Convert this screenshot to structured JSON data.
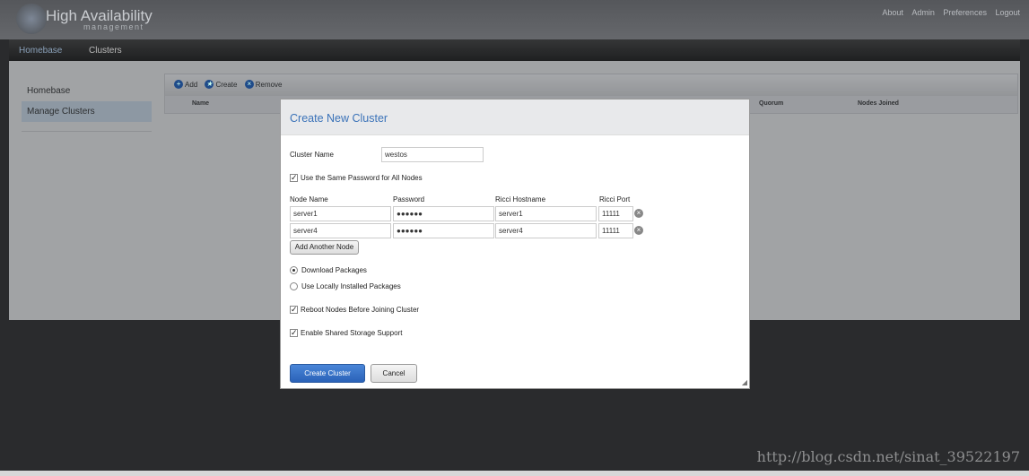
{
  "header": {
    "title": "High Availability",
    "subtitle": "management",
    "links": [
      "About",
      "Admin",
      "Preferences",
      "Logout"
    ]
  },
  "breadcrumb": [
    "Homebase",
    "Clusters"
  ],
  "sidebar": {
    "items": [
      {
        "label": "Homebase"
      },
      {
        "label": "Manage Clusters",
        "selected": true
      }
    ]
  },
  "toolbar": {
    "add": "Add",
    "create": "Create",
    "remove": "Remove"
  },
  "table": {
    "columns": [
      "Name",
      "Quorum",
      "Nodes Joined"
    ]
  },
  "modal": {
    "title": "Create New Cluster",
    "cluster_name_label": "Cluster Name",
    "cluster_name": "westos",
    "same_password_label": "Use the Same Password for All Nodes",
    "same_password": true,
    "columns": [
      "Node Name",
      "Password",
      "Ricci Hostname",
      "Ricci Port"
    ],
    "nodes": [
      {
        "name": "server1",
        "password": "●●●●●●",
        "hostname": "server1",
        "port": "11111"
      },
      {
        "name": "server4",
        "password": "●●●●●●",
        "hostname": "server4",
        "port": "11111"
      }
    ],
    "add_node": "Add Another Node",
    "download_label": "Download Packages",
    "local_label": "Use Locally Installed Packages",
    "package_choice": "Download Packages",
    "reboot_label": "Reboot Nodes Before Joining Cluster",
    "reboot": true,
    "shared_label": "Enable Shared Storage Support",
    "shared": true,
    "create_button": "Create Cluster",
    "cancel_button": "Cancel"
  },
  "watermark": "http://blog.csdn.net/sinat_39522197",
  "colors": {
    "accent": "#3a72b8",
    "button": "#2f6bc0"
  }
}
